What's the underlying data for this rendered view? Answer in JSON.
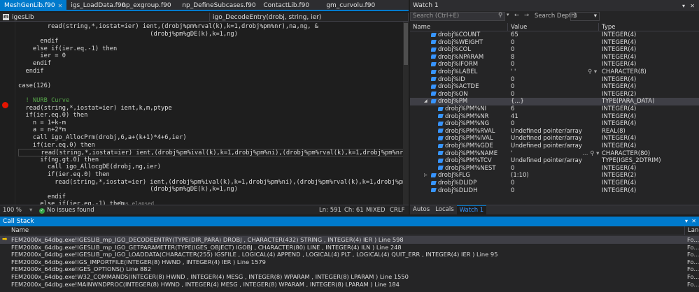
{
  "editor_tabs": [
    {
      "label": "MeshGenLib.f90",
      "active": true
    },
    {
      "label": "igs_LoadData.f90",
      "active": false
    },
    {
      "label": "np_exgroup.f90",
      "active": false
    },
    {
      "label": "np_DefineSubcases.f90",
      "active": false
    },
    {
      "label": "ContactLib.f90",
      "active": false
    },
    {
      "label": "gm_curvolu.f90",
      "active": false
    }
  ],
  "navbar": {
    "module": "igesLib",
    "member": "igo_DecodeEntry(drobj, string, ier)"
  },
  "code_lines": [
    "        read(string,*,iostat=ier) ient,(drobj%pm%rval(k),k=1,drobj%pm%nr),na,ng, &",
    "                                    (drobj%pm%gDE(k),k=1,ng)",
    "      endif",
    "    else if(ier.eq.-1) then",
    "      ier = 0",
    "    endif",
    "  endif",
    "",
    "case(126)",
    "",
    "  ! NURB Curve",
    "  read(string,*,iostat=ier) ient,k,m,ptype",
    "  if(ier.eq.0) then",
    "    n = 1+k-m",
    "    a = n+2*m",
    "    call igo_AllocPrm(drobj,6,a+(k+1)*4+6,ier)",
    "    if(ier.eq.0) then",
    "      read(string,*,iostat=ier) ient,(drobj%pm%ival(k),k=1,drobj%pm%ni),(drobj%pm%rval(k),k=1,drobj%pm%nr),na,ng",
    "      if(ng.gt.0) then",
    "        call igo_AllocgDE(drobj,ng,ier)",
    "        if(ier.eq.0) then",
    "          read(string,*,iostat=ier) ient,(drobj%pm%ival(k),k=1,drobj%pm%ni),(drobj%pm%rval(k),k=1,drobj%pm%nr),na,ng,",
    "                                    (drobj%pm%gDE(k),k=1,ng)",
    "        endif",
    "      else if(ier.eq.-1) then"
  ],
  "elapsed_hint": "≤1ms elapsed",
  "status": {
    "zoom": "100 %",
    "issues": "No issues found",
    "line": "Ln: 591",
    "col": "Ch: 61",
    "mode1": "MIXED",
    "mode2": "CRLF"
  },
  "watch": {
    "title": "Watch 1",
    "search_placeholder": "Search (Ctrl+E)",
    "search_depth_label": "Search Depth:",
    "search_depth_value": "3",
    "columns": [
      "Name",
      "Value",
      "Type"
    ],
    "rows": [
      {
        "name": "drobj%COUNT",
        "value": "65",
        "type": "INTEGER(4)"
      },
      {
        "name": "drobj%WEIGHT",
        "value": "0",
        "type": "INTEGER(4)"
      },
      {
        "name": "drobj%COL",
        "value": "0",
        "type": "INTEGER(4)"
      },
      {
        "name": "drobj%NPARAM",
        "value": "8",
        "type": "INTEGER(4)"
      },
      {
        "name": "drobj%IFORM",
        "value": "0",
        "type": "INTEGER(4)"
      },
      {
        "name": "drobj%LABEL",
        "value": "'        '",
        "type": "CHARACTER(8)"
      },
      {
        "name": "drobj%ID",
        "value": "0",
        "type": "INTEGER(4)"
      },
      {
        "name": "drobj%ACTDE",
        "value": "0",
        "type": "INTEGER(4)"
      },
      {
        "name": "drobj%ON",
        "value": "0",
        "type": "INTEGER(2)"
      },
      {
        "name": "drobj%PM",
        "value": "{...}",
        "type": "TYPE(PARA_DATA)"
      },
      {
        "name": "drobj%PM%NI",
        "value": "6",
        "type": "INTEGER(4)"
      },
      {
        "name": "drobj%PM%NR",
        "value": "41",
        "type": "INTEGER(4)"
      },
      {
        "name": "drobj%PM%NG",
        "value": "0",
        "type": "INTEGER(4)"
      },
      {
        "name": "drobj%PM%RVAL",
        "value": "Undefined pointer/array",
        "type": "REAL(8)"
      },
      {
        "name": "drobj%PM%IVAL",
        "value": "Undefined pointer/array",
        "type": "INTEGER(4)"
      },
      {
        "name": "drobj%PM%GDE",
        "value": "Undefined pointer/array",
        "type": "INTEGER(4)"
      },
      {
        "name": "drobj%PM%NAME",
        "value": "'",
        "type": "CHARACTER(80)"
      },
      {
        "name": "drobj%PM%TCV",
        "value": "Undefined pointer/array",
        "type": "TYPE(IGES_2DTRIM)"
      },
      {
        "name": "drobj%PM%NEST",
        "value": "0",
        "type": "INTEGER(4)"
      },
      {
        "name": "drobj%FLG",
        "value": "(1:10)",
        "type": "INTEGER(2)"
      },
      {
        "name": "drobj%DLIDP",
        "value": "0",
        "type": "INTEGER(4)"
      },
      {
        "name": "drobj%DLIDH",
        "value": "0",
        "type": "INTEGER(4)"
      }
    ],
    "bottom_tabs": [
      "Autos",
      "Locals",
      "Watch 1"
    ]
  },
  "callstack": {
    "title": "Call Stack",
    "columns": [
      "Name",
      "Lang"
    ],
    "rows": [
      {
        "name": "FEM2000x_64dbg.exe!IGESLIB_mp_IGO_DECODEENTRY(TYPE(DIR_PARA) DROBJ , CHARACTER(432) STRING , INTEGER(4)  IER ) Line 598",
        "lang": "Fo..."
      },
      {
        "name": "FEM2000x_64dbg.exe!IGESLIB_mp_IGO_GETPARAMETER(TYPE(IGES_OBJECT) IGOBJ , CHARACTER(80) LINE , INTEGER(4)  ILN ) Line 248",
        "lang": "Fo..."
      },
      {
        "name": "FEM2000x_64dbg.exe!IGESLIB_mp_IGO_LOADDATA(CHARACTER(255) IGSFILE , LOGICAL(4)  APPEND , LOGICAL(4)  PLT , LOGICAL(4)  QUIT_ERR , INTEGER(4)  IER ) Line 95",
        "lang": "Fo..."
      },
      {
        "name": "FEM2000x_64dbg.exe!IGS_IMPORTFILE(INTEGER(8)  HWND , INTEGER(4)  IER ) Line 1579",
        "lang": "Fo..."
      },
      {
        "name": "FEM2000x_64dbg.exe!IGES_OPTIONS() Line 882",
        "lang": "Fo..."
      },
      {
        "name": "FEM2000x_64dbg.exe!W32_COMMANDS(INTEGER(8)  HWND , INTEGER(4)  MESG , INTEGER(8)  WPARAM , INTEGER(8)  LPARAM ) Line 1550",
        "lang": "Fo..."
      },
      {
        "name": "FEM2000x_64dbg.exe!MAINWNDPROC(INTEGER(8)  HWND , INTEGER(4)  MESG , INTEGER(8)  WPARAM , INTEGER(8)  LPARAM ) Line 184",
        "lang": "Fo..."
      }
    ]
  },
  "colors": {
    "accent": "#007acc",
    "breakpoint": "#e51400",
    "ok": "#37a349",
    "current_arrow": "#ffcc00"
  }
}
